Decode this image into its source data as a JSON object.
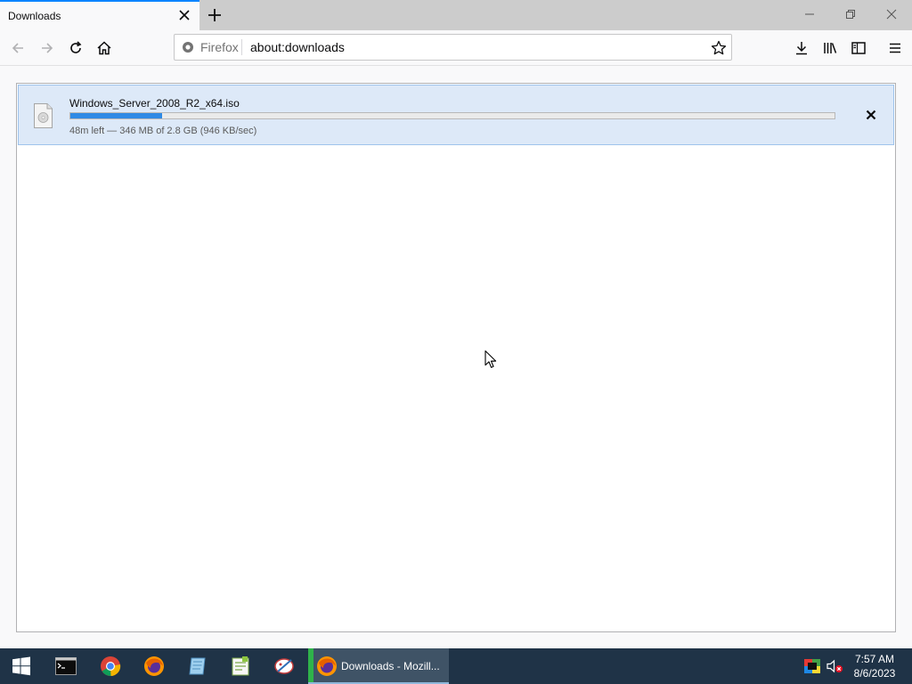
{
  "tab": {
    "title": "Downloads"
  },
  "navbar": {
    "identity_label": "Firefox",
    "url": "about:downloads"
  },
  "download": {
    "file_name": "Windows_Server_2008_R2_x64.iso",
    "progress_percent": 12,
    "status": "48m left — 346 MB of 2.8 GB (946 KB/sec)"
  },
  "taskbar": {
    "active_window_label": "Downloads - Mozill...",
    "time": "7:57 AM",
    "date": "8/6/2023"
  },
  "colors": {
    "accent": "#0a84ff",
    "progress": "#2f8ae5",
    "download_highlight": "#dde9f8",
    "taskbar": "#1f3347"
  },
  "icons": {
    "tab_close": "close-icon",
    "new_tab": "plus-icon",
    "back": "back-arrow-icon",
    "forward": "forward-arrow-icon",
    "reload": "reload-icon",
    "home": "home-icon",
    "bookmark": "star-icon",
    "downloads": "download-icon",
    "library": "library-icon",
    "sidebar": "sidebar-icon",
    "menu": "hamburger-menu-icon"
  }
}
